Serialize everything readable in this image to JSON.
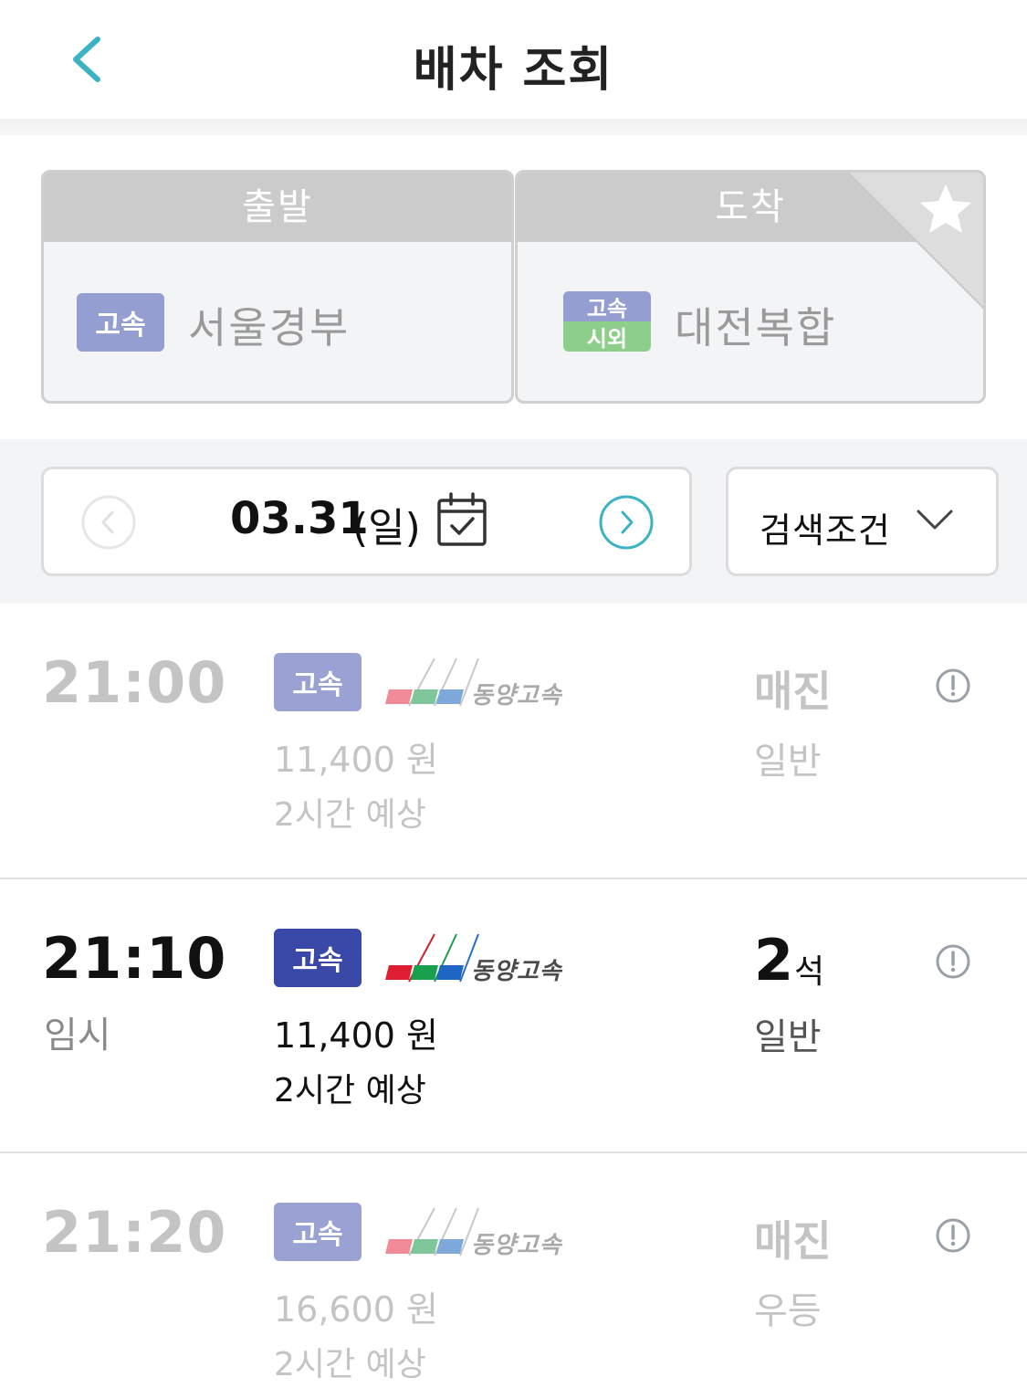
{
  "header": {
    "title": "배차 조회"
  },
  "route": {
    "departure": {
      "label": "출발",
      "terminal_type": "고속",
      "terminal_name": "서울경부"
    },
    "arrival": {
      "label": "도착",
      "terminal_type_top": "고속",
      "terminal_type_bottom": "시외",
      "terminal_name": "대전복합"
    }
  },
  "date": {
    "value": "03.31",
    "day": "(일)"
  },
  "filter": {
    "label": "검색조건"
  },
  "schedules": [
    {
      "time": "21:00",
      "note": "",
      "grade": "고속",
      "company": "동양고속",
      "fare": "11,400 원",
      "duration": "2시간 예상",
      "seat_status": "매진",
      "bus_class": "일반"
    },
    {
      "time": "21:10",
      "note": "임시",
      "grade": "고속",
      "company": "동양고속",
      "fare": "11,400 원",
      "duration": "2시간 예상",
      "seats": "2",
      "seat_unit": "석",
      "bus_class": "일반"
    },
    {
      "time": "21:20",
      "note": "",
      "grade": "고속",
      "company": "동양고속",
      "fare": "16,600 원",
      "duration": "2시간 예상",
      "seat_status": "매진",
      "bus_class": "우등"
    }
  ],
  "colors": {
    "accent": "#3bb3c3",
    "badge_express": "#949ed1",
    "badge_intercity": "#8dcf8a",
    "badge_active": "#3a48a8"
  }
}
